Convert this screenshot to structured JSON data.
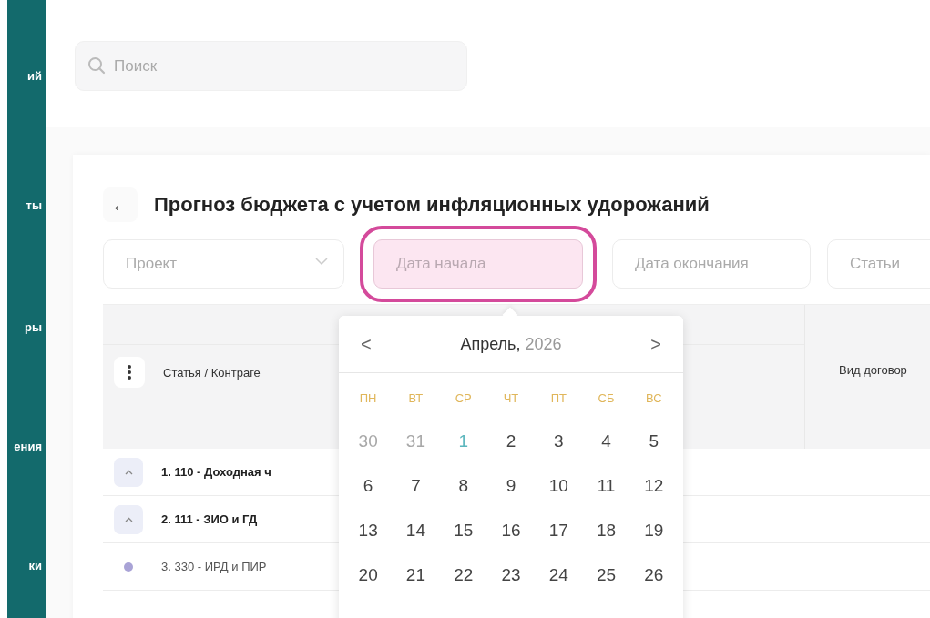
{
  "sidebar": {
    "items": [
      {
        "label": "ий"
      },
      {
        "label": "ты"
      },
      {
        "label": "ры"
      },
      {
        "label": "ения"
      },
      {
        "label": "ки"
      }
    ]
  },
  "search": {
    "placeholder": "Поиск"
  },
  "page": {
    "back": "←",
    "title": "Прогноз бюджета с учетом инфляционных удорожаний"
  },
  "filters": [
    {
      "kind": "select",
      "placeholder": "Проект",
      "focused": false
    },
    {
      "kind": "date",
      "placeholder": "Дата начала",
      "focused": true
    },
    {
      "kind": "date",
      "placeholder": "Дата окончания",
      "focused": false
    },
    {
      "kind": "text",
      "placeholder": "Статьи",
      "focused": false
    }
  ],
  "table": {
    "columns": [
      "Статья / Контраге",
      "Вид договор"
    ],
    "rows": [
      {
        "kind": "group",
        "label": "1. 110 - Доходная ч",
        "expanded": true
      },
      {
        "kind": "group",
        "label": "2. 111 - ЗИО и ГД",
        "expanded": true
      },
      {
        "kind": "item",
        "label": "3. 330 - ИРД и ПИР",
        "color": "#a9a3d6"
      }
    ]
  },
  "calendar": {
    "prev": "<",
    "month": "Апрель,",
    "year": "2026",
    "next": ">",
    "weekdays": [
      "ПН",
      "ВТ",
      "СР",
      "ЧТ",
      "ПТ",
      "СБ",
      "ВС"
    ],
    "days": [
      {
        "label": "30",
        "kind": "other"
      },
      {
        "label": "31",
        "kind": "other"
      },
      {
        "label": "1",
        "kind": "today"
      },
      {
        "label": "2",
        "kind": "normal"
      },
      {
        "label": "3",
        "kind": "normal"
      },
      {
        "label": "4",
        "kind": "normal"
      },
      {
        "label": "5",
        "kind": "normal"
      },
      {
        "label": "6",
        "kind": "normal"
      },
      {
        "label": "7",
        "kind": "normal"
      },
      {
        "label": "8",
        "kind": "normal"
      },
      {
        "label": "9",
        "kind": "normal"
      },
      {
        "label": "10",
        "kind": "normal"
      },
      {
        "label": "11",
        "kind": "normal"
      },
      {
        "label": "12",
        "kind": "normal"
      },
      {
        "label": "13",
        "kind": "normal"
      },
      {
        "label": "14",
        "kind": "normal"
      },
      {
        "label": "15",
        "kind": "normal"
      },
      {
        "label": "16",
        "kind": "normal"
      },
      {
        "label": "17",
        "kind": "normal"
      },
      {
        "label": "18",
        "kind": "normal"
      },
      {
        "label": "19",
        "kind": "normal"
      },
      {
        "label": "20",
        "kind": "normal"
      },
      {
        "label": "21",
        "kind": "normal"
      },
      {
        "label": "22",
        "kind": "normal"
      },
      {
        "label": "23",
        "kind": "normal"
      },
      {
        "label": "24",
        "kind": "normal"
      },
      {
        "label": "25",
        "kind": "normal"
      },
      {
        "label": "26",
        "kind": "normal"
      }
    ]
  }
}
